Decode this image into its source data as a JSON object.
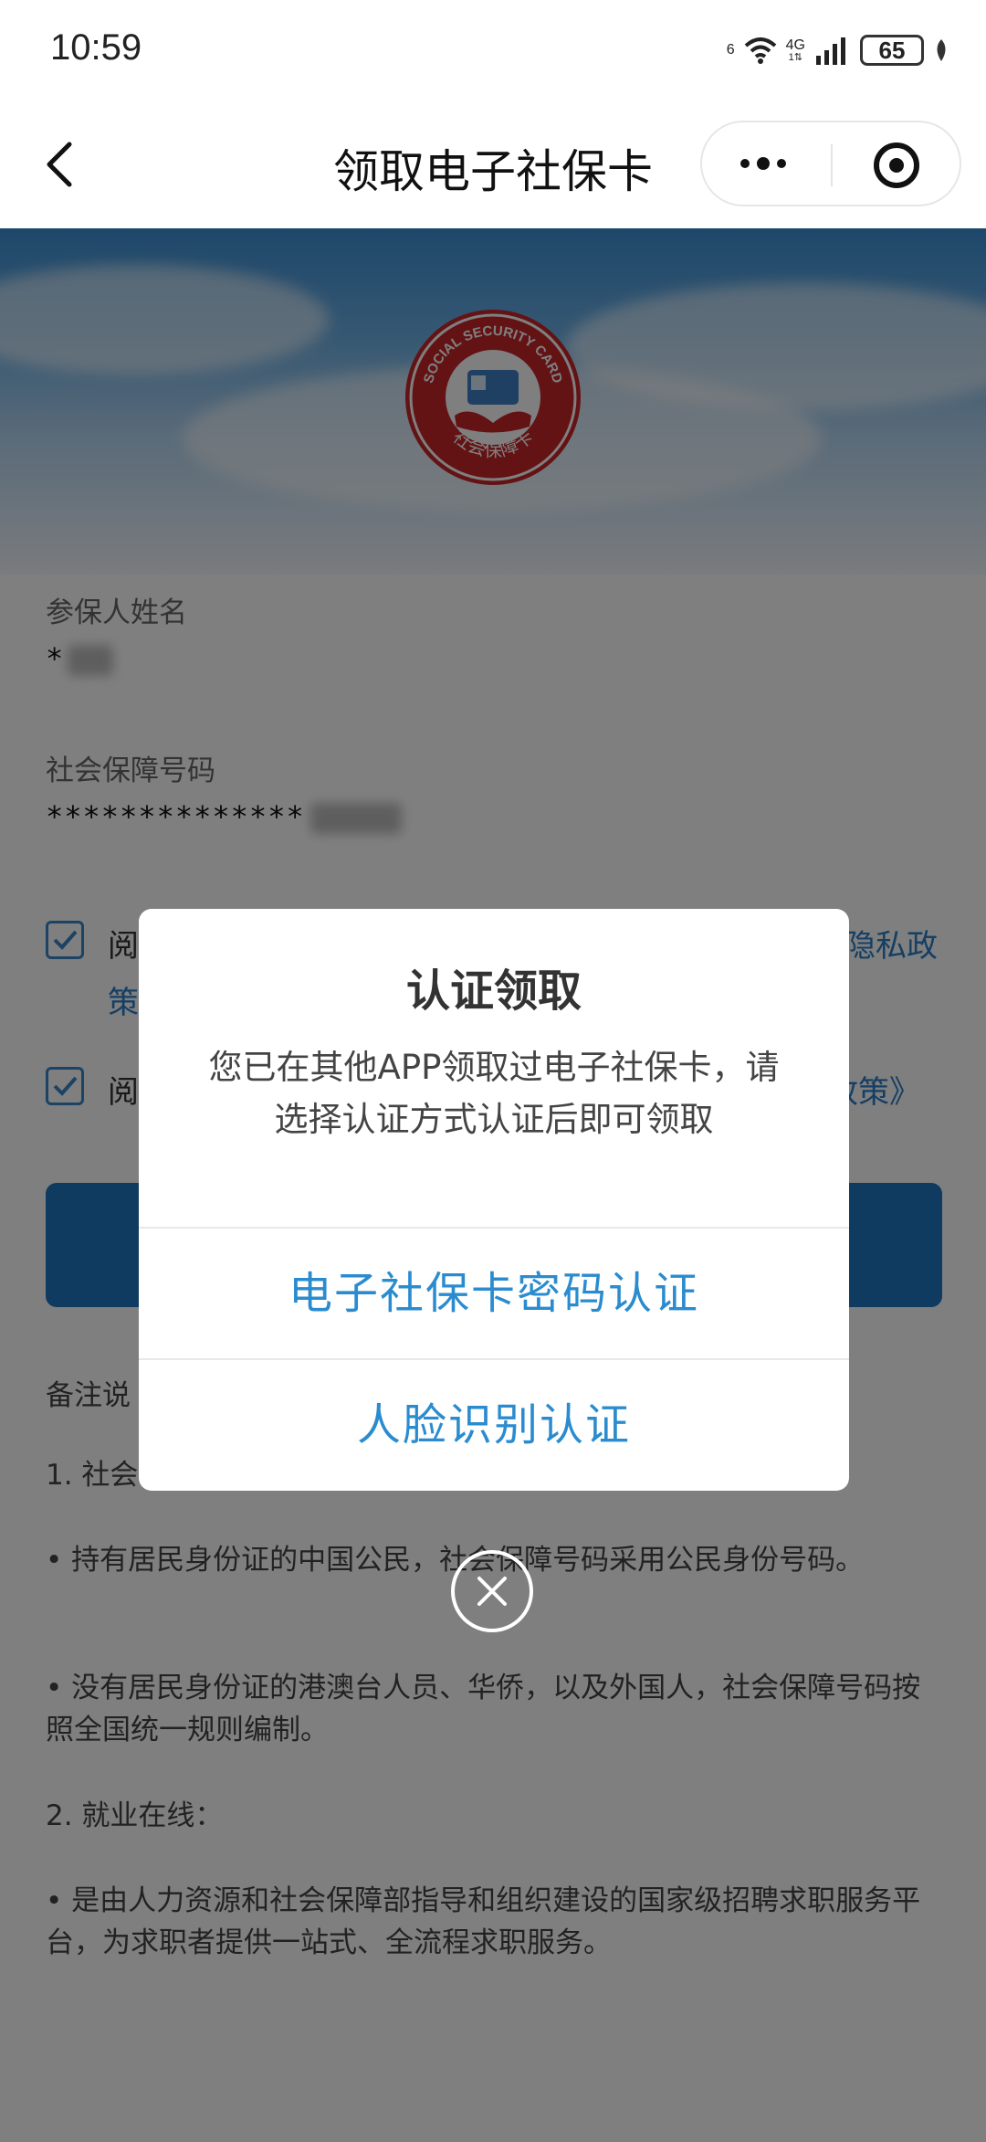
{
  "status_bar": {
    "time": "10:59",
    "wifi_badge": "6",
    "network_type": "4G",
    "network_sub": "1⇅",
    "battery": "65"
  },
  "nav": {
    "title": "领取电子社保卡"
  },
  "form": {
    "name_label": "参保人姓名",
    "name_value": "*",
    "ssn_label": "社会保障号码",
    "ssn_value": "**************",
    "agree1_left": "阅",
    "agree1_right": "隐私政",
    "agree1_line2": "策",
    "agree2_left": "阅",
    "agree2_right": "政策》"
  },
  "notes": {
    "heading": "备注说",
    "item1_title": "1. 社会",
    "item1_bullet1": "• 持有居民身份证的中国公民，社会保障号码采用公民身份号码。",
    "item1_bullet2": "• 没有居民身份证的港澳台人员、华侨，以及外国人，社会保障号码按照全国统一规则编制。",
    "item2_title": "2. 就业在线：",
    "item2_bullet1": "• 是由人力资源和社会保障部指导和组织建设的国家级招聘求职服务平台，为求职者提供一站式、全流程求职服务。"
  },
  "modal": {
    "title": "认证领取",
    "message": "您已在其他APP领取过电子社保卡，请选择认证方式认证后即可领取",
    "option_password": "电子社保卡密码认证",
    "option_face": "人脸识别认证"
  },
  "logo": {
    "text_top": "SOCIAL SECURITY CARD",
    "text_bottom": "社会保障卡"
  },
  "colors": {
    "accent": "#2a8ccf",
    "primary_button": "#1f77c3",
    "logo_red": "#c8262b"
  }
}
